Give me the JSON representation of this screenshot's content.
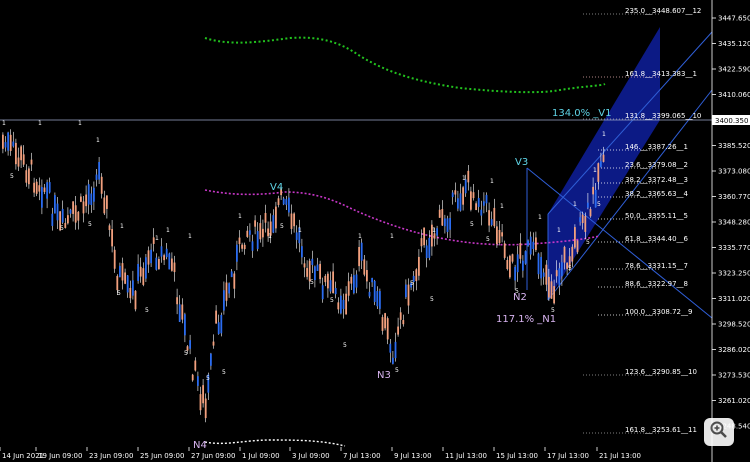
{
  "colors": {
    "background": "#000000",
    "bull": "#2b6cf0",
    "bear": "#f2a07e",
    "wick": "#ffffff",
    "axis_text": "#ffffff",
    "green_curve": "#22c21e",
    "magenta_curve": "#c837c8",
    "white_dotted": "#ffffff",
    "channel_fill": "#0d1b8c",
    "channel_line": "#2f5ed6",
    "cyan_label": "#5fd4e6",
    "lilac_label": "#d8b4f0",
    "crosshair": "#9aa6c8",
    "price_tag_bg": "#ffffff"
  },
  "price_axis": {
    "ticks": [
      "3447.650",
      "3435.120",
      "3422.590",
      "3410.060",
      "3397.520",
      "3385.520",
      "3373.080",
      "3360.770",
      "3348.280",
      "3335.770",
      "3323.250",
      "3311.020",
      "3298.520",
      "3286.020",
      "3273.530",
      "3261.020",
      "3248.540"
    ],
    "current_price": "3400.350"
  },
  "time_axis": {
    "ticks": [
      "14 Jun 2021",
      "19 Jun 09:00",
      "23 Jun 09:00",
      "25 Jun 09:00",
      "27 Jun 09:00",
      "1 Jul 09:00",
      "3 Jul 09:00",
      "7 Jul 13:00",
      "9 Jul 13:00",
      "11 Jul 13:00",
      "15 Jul 13:00",
      "17 Jul 13:00",
      "21 Jul 13:00"
    ]
  },
  "fib_levels": [
    {
      "label": "235.0__3448.607__12",
      "color": "#a8a8a8"
    },
    {
      "label": "161.8__3413.383__1",
      "color": "#e8b0b0"
    },
    {
      "label": "131.8__3399.065__10",
      "color": "#a8a8a8"
    },
    {
      "label": "146.__3387.26__1",
      "color": "#ffffff"
    },
    {
      "label": "23.6__3379.08__2",
      "color": "#ffffff"
    },
    {
      "label": "38.2__3372.48__3",
      "color": "#ffffff"
    },
    {
      "label": "38.2__3365.63__4",
      "color": "#ffffff"
    },
    {
      "label": "50.0__3355.11__5",
      "color": "#ffffff"
    },
    {
      "label": "61.8__3344.40__6",
      "color": "#ffffff"
    },
    {
      "label": "78.6__3331.15__7",
      "color": "#ffffff"
    },
    {
      "label": "88.6__3322.97__8",
      "color": "#ffffff"
    },
    {
      "label": "100.0__3308.72__9",
      "color": "#ffffff"
    },
    {
      "label": "123.6__3290.85__10",
      "color": "#a8a8a8"
    },
    {
      "label": "161.8__3253.61__11",
      "color": "#a8a8a8"
    }
  ],
  "wave_labels": {
    "v1": "134.0% _V1",
    "v4": "V4",
    "v3": "V3",
    "n1": "117.1% _N1",
    "n2": "N2",
    "n3": "N3",
    "n4": "N4"
  },
  "small_markers": {
    "one": "1",
    "five": "5"
  },
  "zoom_button": {
    "icon": "magnifier-plus-icon"
  }
}
